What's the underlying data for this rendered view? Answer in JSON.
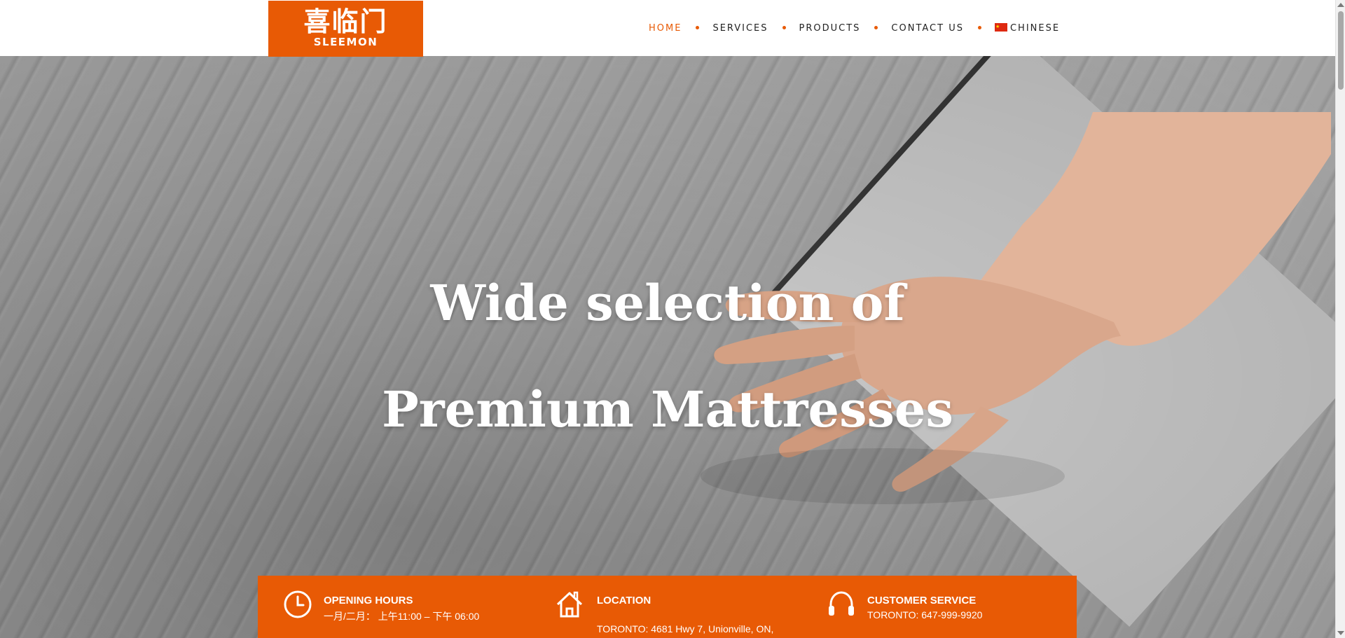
{
  "header": {
    "logo_cn": "喜临门",
    "logo_en": "SLEEMON"
  },
  "nav": {
    "items": [
      {
        "label": "HOME",
        "active": true
      },
      {
        "label": "SERVICES",
        "active": false
      },
      {
        "label": "PRODUCTS",
        "active": false
      },
      {
        "label": "CONTACT US",
        "active": false
      },
      {
        "label": "CHINESE",
        "active": false,
        "icon": "china-flag-icon"
      }
    ]
  },
  "hero": {
    "line1": "Wide selection of",
    "line2": "Premium Mattresses"
  },
  "info": {
    "hours": {
      "icon": "clock-icon",
      "title": "OPENING HOURS",
      "text": "一月/二月：  上午11:00 – 下午 06:00"
    },
    "location": {
      "icon": "home-icon",
      "title": "LOCATION",
      "text": "TORONTO:  4681 Hwy 7, Unionville, ON,"
    },
    "service": {
      "icon": "headset-icon",
      "title": "CUSTOMER SERVICE",
      "text": "TORONTO: 647-999-9920"
    }
  },
  "colors": {
    "accent": "#e85a05",
    "nav_text": "#222222",
    "white": "#ffffff"
  }
}
